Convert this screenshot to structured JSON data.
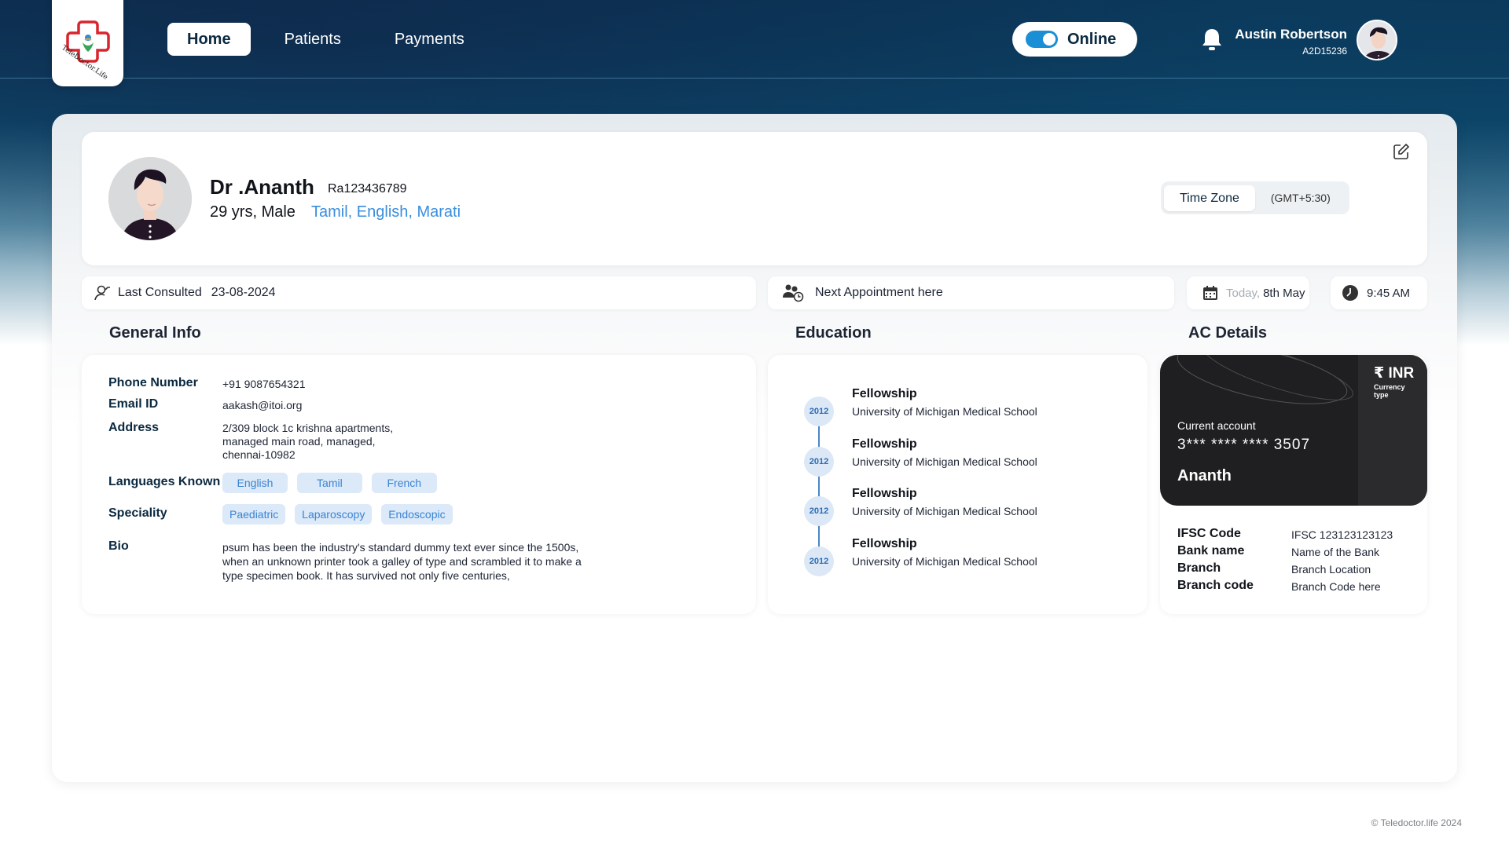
{
  "header": {
    "logo_text": "TeleDoctor.Life",
    "nav": [
      {
        "label": "Home",
        "active": true
      },
      {
        "label": "Patients",
        "active": false
      },
      {
        "label": "Payments",
        "active": false
      }
    ],
    "status_label": "Online",
    "user_name": "Austin Robertson",
    "user_id": "A2D15236"
  },
  "profile": {
    "name": "Dr .Ananth",
    "id": "Ra123436789",
    "age_gender": "29 yrs, Male",
    "languages": "Tamil, English, Marati",
    "timezone_label": "Time Zone",
    "timezone_value": "(GMT+5:30)"
  },
  "strip": {
    "last_consulted_label": "Last Consulted",
    "last_consulted_date": "23-08-2024",
    "next_appointment": "Next Appointment here",
    "today_label": "Today,",
    "today_date": "8th May",
    "time": "9:45 AM"
  },
  "general_info": {
    "title": "General Info",
    "phone_label": "Phone Number",
    "phone": "+91 9087654321",
    "email_label": "Email ID",
    "email": "aakash@itoi.org",
    "address_label": "Address",
    "address_lines": [
      "2/309 block 1c krishna apartments,",
      "managed main road, managed,",
      "chennai-10982"
    ],
    "languages_label": "Languages Known",
    "languages": [
      "English",
      "Tamil",
      "French"
    ],
    "speciality_label": "Speciality",
    "specialities": [
      "Paediatric",
      "Laparoscopy",
      "Endoscopic"
    ],
    "bio_label": "Bio",
    "bio_lines": [
      "psum has been the industry's standard dummy text ever since the 1500s,",
      "when an unknown printer took a galley of type and scrambled it to make a",
      "type specimen book. It has survived not only five centuries,"
    ]
  },
  "education": {
    "title": "Education",
    "items": [
      {
        "year": "2012",
        "title": "Fellowship",
        "school": "University of Michigan Medical School"
      },
      {
        "year": "2012",
        "title": "Fellowship",
        "school": "University of Michigan Medical School"
      },
      {
        "year": "2012",
        "title": "Fellowship",
        "school": "University of Michigan Medical School"
      },
      {
        "year": "2012",
        "title": "Fellowship",
        "school": "University of Michigan Medical School"
      }
    ]
  },
  "ac_details": {
    "title": "AC Details",
    "card": {
      "currency": "₹ INR",
      "currency_caption_1": "Currency",
      "currency_caption_2": "type",
      "account_type": "Current account",
      "number": "3*** **** **** 3507",
      "holder": "Ananth"
    },
    "fields": [
      {
        "label": "IFSC Code",
        "value": "IFSC 123123123123"
      },
      {
        "label": "Bank name",
        "value": "Name of the Bank"
      },
      {
        "label": "Branch",
        "value": "Branch Location"
      },
      {
        "label": "Branch code",
        "value": "Branch Code here"
      }
    ]
  },
  "footer": "© Teledoctor.life 2024",
  "colors": {
    "accent": "#1b8fd6",
    "chip_bg": "#dbe9f8",
    "chip_text": "#3a84d4",
    "header_dark": "#0c3556"
  }
}
